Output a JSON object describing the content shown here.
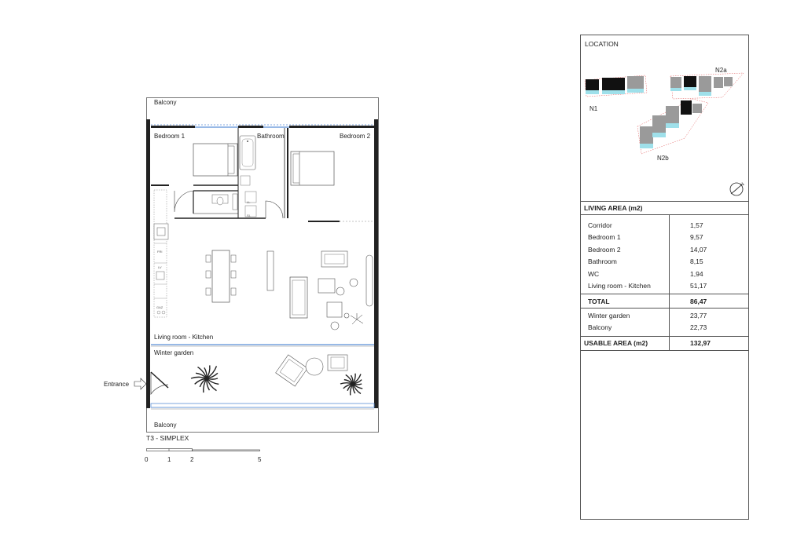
{
  "plan": {
    "rooms": {
      "balcony_top": "Balcony",
      "bedroom1": "Bedroom 1",
      "bathroom": "Bathroom",
      "bedroom2": "Bedroom 2",
      "living_kitchen": "Living room - Kitchen",
      "winter_garden": "Winter garden",
      "balcony_bottom": "Balcony",
      "entrance": "Entrance"
    },
    "fixture_labels": {
      "ll": "LL",
      "sl": "SL",
      "frig": "FRI",
      "lv": "LV",
      "gaz": "GAZ"
    },
    "title": "T3 - SIMPLEX",
    "scale_ticks": [
      "0",
      "1",
      "2",
      "5"
    ]
  },
  "panel": {
    "location_title": "LOCATION",
    "location_labels": [
      "N1",
      "N2a",
      "N2b"
    ],
    "north": "N",
    "living_area_title": "LIVING AREA (m2)",
    "rows": [
      {
        "name": "Corridor",
        "value": "1,57"
      },
      {
        "name": "Bedroom 1",
        "value": "9,57"
      },
      {
        "name": "Bedroom 2",
        "value": "14,07"
      },
      {
        "name": "Bathroom",
        "value": "8,15"
      },
      {
        "name": "WC",
        "value": "1,94"
      },
      {
        "name": "Living room - Kitchen",
        "value": "51,17"
      }
    ],
    "total": {
      "name": "TOTAL",
      "value": "86,47"
    },
    "extra_rows": [
      {
        "name": "Winter garden",
        "value": "23,77"
      },
      {
        "name": "Balcony",
        "value": "22,73"
      }
    ],
    "usable": {
      "name": "USABLE AREA (m2)",
      "value": "132,97"
    }
  },
  "colors": {
    "wall": "#222222",
    "glazing": "#5b8fd6",
    "fixture": "#666666",
    "location_glazing": "#9fe0ea",
    "location_building": "#9a9a9a",
    "location_selected": "#111111",
    "location_outline": "#e05050"
  }
}
